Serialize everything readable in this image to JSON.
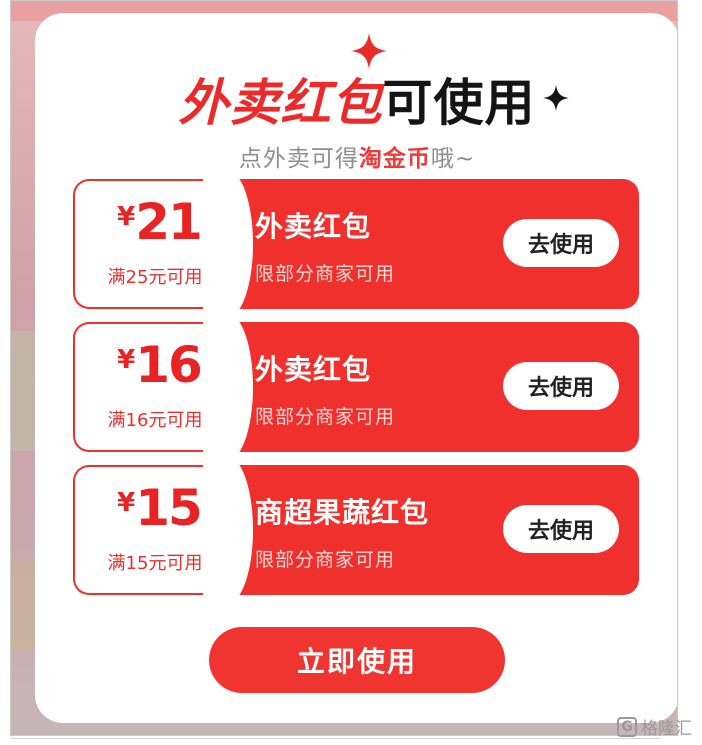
{
  "dialog": {
    "title_red": "外卖红包",
    "title_dark": "可使用",
    "subtitle_pre": "点外卖可得",
    "subtitle_highlight": "淘金币",
    "subtitle_post": "哦~"
  },
  "coupons": [
    {
      "currency": "¥",
      "amount": "21",
      "condition": "满25元可用",
      "name": "外卖红包",
      "scope": "限部分商家可用",
      "button": "去使用"
    },
    {
      "currency": "¥",
      "amount": "16",
      "condition": "满16元可用",
      "name": "外卖红包",
      "scope": "限部分商家可用",
      "button": "去使用"
    },
    {
      "currency": "¥",
      "amount": "15",
      "condition": "满15元可用",
      "name": "商超果蔬红包",
      "scope": "限部分商家可用",
      "button": "去使用"
    }
  ],
  "primary_button": "立即使用",
  "watermark": "格隆汇",
  "icons": {
    "sparkle_red": "sparkle-icon",
    "sparkle_dark": "sparkle-icon",
    "watermark_logo": "g-logo-icon"
  },
  "colors": {
    "brand_red": "#f0302d",
    "text_red": "#e82323",
    "overlay": "#cfa2a8"
  }
}
